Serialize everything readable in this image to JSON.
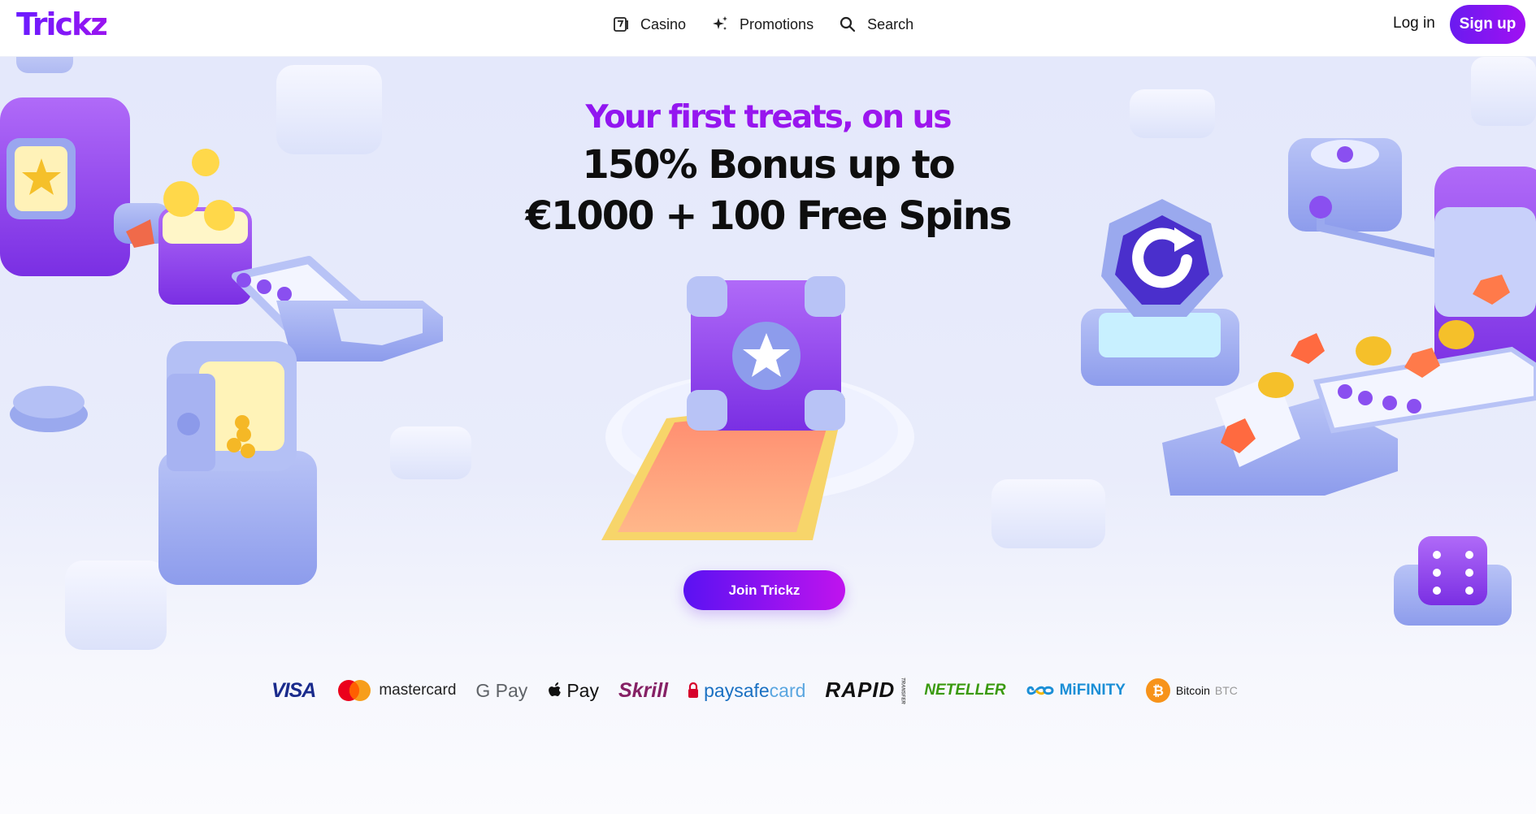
{
  "header": {
    "logo": "Trickz",
    "nav": [
      {
        "label": "Casino",
        "icon": "casino-icon"
      },
      {
        "label": "Promotions",
        "icon": "sparkles-icon"
      },
      {
        "label": "Search",
        "icon": "search-icon"
      }
    ],
    "login_label": "Log in",
    "signup_label": "Sign up"
  },
  "hero": {
    "tagline": "Your first treats, on us",
    "bonus_line1": "150% Bonus up to",
    "bonus_line2": "€1000 + 100 Free Spins",
    "cta_label": "Join Trickz"
  },
  "payments": {
    "visa": "VISA",
    "mastercard": "mastercard",
    "gpay": "G Pay",
    "applepay": "Pay",
    "skrill": "Skrill",
    "paysafecard_a": "paysafe",
    "paysafecard_b": "card",
    "rapid": "RAPID",
    "rapid_small": "TRANSFER",
    "neteller": "NETELLER",
    "mifinity": "MiFINITY",
    "bitcoin": "Bitcoin",
    "bitcoin_sub": "BTC"
  },
  "colors": {
    "brand_purple": "#7a18f5",
    "brand_magenta": "#b514e8",
    "hero_bg": "#e6e9fb"
  }
}
